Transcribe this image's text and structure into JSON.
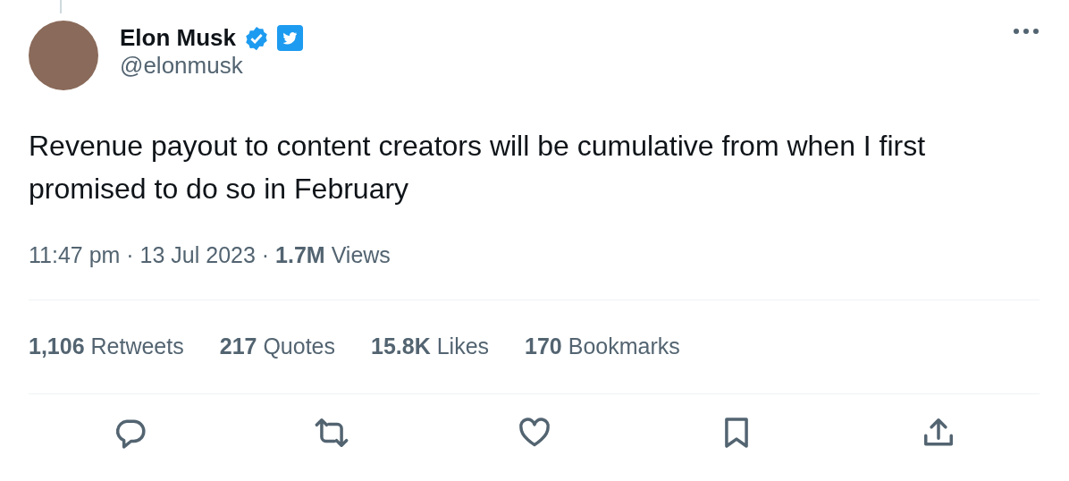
{
  "author": {
    "name": "Elon Musk",
    "handle": "@elonmusk",
    "verified": true
  },
  "tweet": {
    "text": "Revenue payout to content creators will be cumulative from when I first promised to do so in February",
    "meta": "11:47 pm · 13 Jul 2023 · **1.7M** Views"
  },
  "stats": [
    {
      "text": "**1,106** Retweets"
    },
    {
      "text": "**217** Quotes"
    },
    {
      "text": "**15.8K** Likes"
    },
    {
      "text": "**170** Bookmarks"
    }
  ],
  "actions": [
    {
      "kind": "reply"
    },
    {
      "kind": "retweet"
    },
    {
      "kind": "like"
    },
    {
      "kind": "bookmark"
    },
    {
      "kind": "share"
    }
  ]
}
